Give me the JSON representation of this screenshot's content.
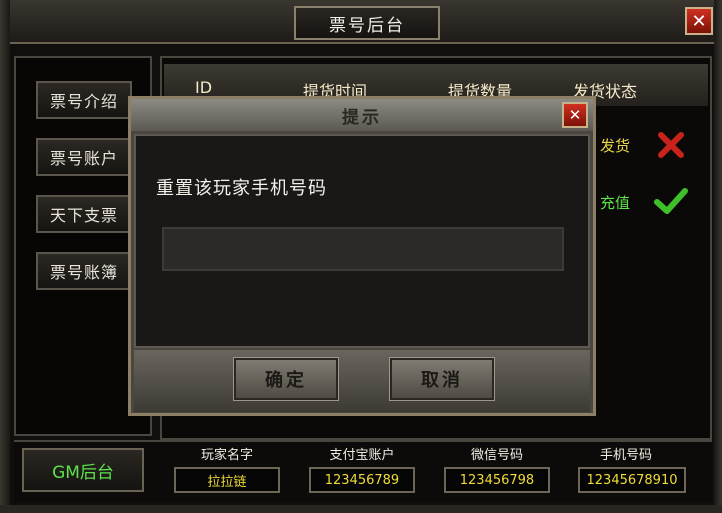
{
  "window": {
    "title": "票号后台",
    "close_icon": "close-icon"
  },
  "sidebar": {
    "items": [
      {
        "label": "票号介绍"
      },
      {
        "label": "票号账户"
      },
      {
        "label": "天下支票"
      },
      {
        "label": "票号账簿"
      }
    ]
  },
  "table": {
    "headers": [
      "ID",
      "提货时间",
      "提货数量",
      "发货状态"
    ],
    "rows": [
      {
        "status": "发货",
        "icon": "cross-icon",
        "status_color": "#e8d84a"
      },
      {
        "status": "充值",
        "icon": "check-icon",
        "status_color": "#5fe24a"
      }
    ]
  },
  "bottom": {
    "gm_button": "GM后台",
    "fields": [
      {
        "label": "玩家名字",
        "value": "拉拉链"
      },
      {
        "label": "支付宝账户",
        "value": "123456789"
      },
      {
        "label": "微信号码",
        "value": "123456798"
      },
      {
        "label": "手机号码",
        "value": "12345678910"
      }
    ]
  },
  "dialog": {
    "title": "提示",
    "message": "重置该玩家手机号码",
    "input_value": "",
    "confirm": "确定",
    "cancel": "取消"
  },
  "colors": {
    "accent_green": "#5ce24a",
    "accent_yellow": "#f0dc36",
    "close_red": "#c62a1a"
  }
}
